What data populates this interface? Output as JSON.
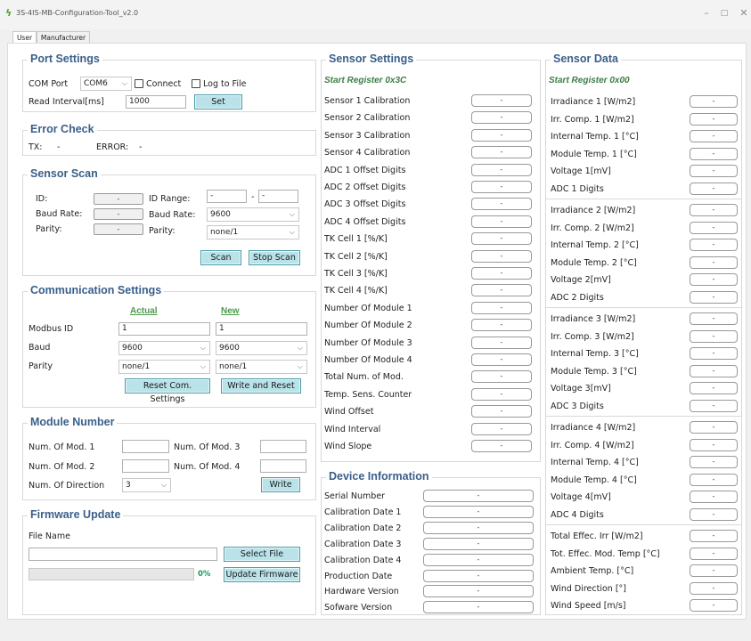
{
  "app": {
    "title": "3S-4IS-MB-Configuration-Tool_v2.0"
  },
  "tabs": [
    "User",
    "Manufacturer"
  ],
  "port": {
    "title": "Port Settings",
    "com_label": "COM Port",
    "com_value": "COM6",
    "connect_label": "Connect",
    "log_label": "Log to File",
    "interval_label": "Read Interval[ms]",
    "interval_value": "1000",
    "set_label": "Set"
  },
  "error": {
    "title": "Error Check",
    "tx_label": "TX:",
    "tx_value": "-",
    "err_label": "ERROR:",
    "err_value": "-"
  },
  "scan": {
    "title": "Sensor Scan",
    "id_label": "ID:",
    "id_value": "-",
    "baud_label": "Baud Rate:",
    "baud_value": "-",
    "parity_label": "Parity:",
    "parity_value": "-",
    "range_label": "ID Range:",
    "range_from": "-",
    "range_dash": "-",
    "range_to": "-",
    "baud2_label": "Baud Rate:",
    "baud2_value": "9600",
    "parity2_label": "Parity:",
    "parity2_value": "none/1",
    "scan_label": "Scan",
    "stop_label": "Stop Scan"
  },
  "comm": {
    "title": "Communication Settings",
    "actual": "Actual",
    "new": "New",
    "modbus_label": "Modbus ID",
    "modbus_actual": "1",
    "modbus_new": "1",
    "baud_label": "Baud",
    "baud_actual": "9600",
    "baud_new": "9600",
    "parity_label": "Parity",
    "parity_actual": "none/1",
    "parity_new": "none/1",
    "reset_label": "Reset Com. Settings",
    "write_label": "Write and Reset"
  },
  "module": {
    "title": "Module Number",
    "mod1": "Num. Of Mod. 1",
    "mod2": "Num. Of Mod. 2",
    "mod3": "Num. Of Mod. 3",
    "mod4": "Num. Of Mod. 4",
    "dir_label": "Num. Of Direction",
    "dir_value": "3",
    "write_label": "Write"
  },
  "fw": {
    "title": "Firmware Update",
    "file_label": "File Name",
    "select_label": "Select File",
    "progress": 0,
    "pct": "0%",
    "update_label": "Update Firmware"
  },
  "sensor_settings": {
    "title": "Sensor Settings",
    "start": "Start Register 0x3C",
    "items": [
      {
        "label": "Sensor 1 Calibration",
        "value": "-"
      },
      {
        "label": "Sensor 2 Calibration",
        "value": "-"
      },
      {
        "label": "Sensor 3 Calibration",
        "value": "-"
      },
      {
        "label": "Sensor 4 Calibration",
        "value": "-"
      },
      {
        "label": "ADC 1 Offset Digits",
        "value": "-"
      },
      {
        "label": "ADC 2 Offset Digits",
        "value": "-"
      },
      {
        "label": "ADC 3 Offset Digits",
        "value": "-"
      },
      {
        "label": "ADC 4 Offset Digits",
        "value": "-"
      },
      {
        "label": "TK Cell 1 [%/K]",
        "value": "-"
      },
      {
        "label": "TK Cell 2 [%/K]",
        "value": "-"
      },
      {
        "label": "TK Cell 3 [%/K]",
        "value": "-"
      },
      {
        "label": "TK Cell 4 [%/K]",
        "value": "-"
      },
      {
        "label": "Number Of Module 1",
        "value": "-"
      },
      {
        "label": "Number Of Module 2",
        "value": "-"
      },
      {
        "label": "Number Of Module 3",
        "value": "-"
      },
      {
        "label": "Number Of Module 4",
        "value": "-"
      },
      {
        "label": "Total Num. of Mod.",
        "value": "-"
      },
      {
        "label": "Temp. Sens. Counter",
        "value": "-"
      },
      {
        "label": "Wind Offset",
        "value": "-"
      },
      {
        "label": "Wind Interval",
        "value": "-"
      },
      {
        "label": "Wind Slope",
        "value": "-"
      }
    ]
  },
  "device": {
    "title": "Device Information",
    "items": [
      {
        "label": "Serial Number",
        "value": "-"
      },
      {
        "label": "Calibration Date 1",
        "value": "-"
      },
      {
        "label": "Calibration Date 2",
        "value": "-"
      },
      {
        "label": "Calibration Date 3",
        "value": "-"
      },
      {
        "label": "Calibration Date 4",
        "value": "-"
      },
      {
        "label": "Production Date",
        "value": "-"
      },
      {
        "label": "Hardware Version",
        "value": "-"
      },
      {
        "label": "Sofware Version",
        "value": "-"
      }
    ]
  },
  "sensor_data": {
    "title": "Sensor Data",
    "start": "Start Register 0x00",
    "groups": [
      [
        {
          "label": "Irradiance 1 [W/m2]",
          "value": "-"
        },
        {
          "label": "Irr. Comp. 1 [W/m2]",
          "value": "-"
        },
        {
          "label": "Internal Temp. 1 [°C]",
          "value": "-"
        },
        {
          "label": "Module Temp. 1 [°C]",
          "value": "-"
        },
        {
          "label": "Voltage 1[mV]",
          "value": "-"
        },
        {
          "label": "ADC 1 Digits",
          "value": "-"
        }
      ],
      [
        {
          "label": "Irradiance 2 [W/m2]",
          "value": "-"
        },
        {
          "label": "Irr. Comp. 2 [W/m2]",
          "value": "-"
        },
        {
          "label": "Internal Temp. 2 [°C]",
          "value": "-"
        },
        {
          "label": "Module Temp. 2 [°C]",
          "value": "-"
        },
        {
          "label": "Voltage 2[mV]",
          "value": "-"
        },
        {
          "label": "ADC 2 Digits",
          "value": "-"
        }
      ],
      [
        {
          "label": "Irradiance 3 [W/m2]",
          "value": "-"
        },
        {
          "label": "Irr. Comp. 3 [W/m2]",
          "value": "-"
        },
        {
          "label": "Internal Temp. 3 [°C]",
          "value": "-"
        },
        {
          "label": "Module Temp. 3 [°C]",
          "value": "-"
        },
        {
          "label": "Voltage 3[mV]",
          "value": "-"
        },
        {
          "label": "ADC 3 Digits",
          "value": "-"
        }
      ],
      [
        {
          "label": "Irradiance 4 [W/m2]",
          "value": "-"
        },
        {
          "label": "Irr. Comp. 4 [W/m2]",
          "value": "-"
        },
        {
          "label": "Internal Temp. 4 [°C]",
          "value": "-"
        },
        {
          "label": "Module Temp. 4 [°C]",
          "value": "-"
        },
        {
          "label": "Voltage 4[mV]",
          "value": "-"
        },
        {
          "label": "ADC 4 Digits",
          "value": "-"
        }
      ],
      [
        {
          "label": "Total Effec. Irr [W/m2]",
          "value": "-"
        },
        {
          "label": "Tot. Effec. Mod. Temp [°C]",
          "value": "-"
        },
        {
          "label": "Ambient Temp. [°C]",
          "value": "-"
        },
        {
          "label": "Wind Direction [°]",
          "value": "-"
        },
        {
          "label": "Wind Speed [m/s]",
          "value": "-"
        }
      ]
    ]
  }
}
